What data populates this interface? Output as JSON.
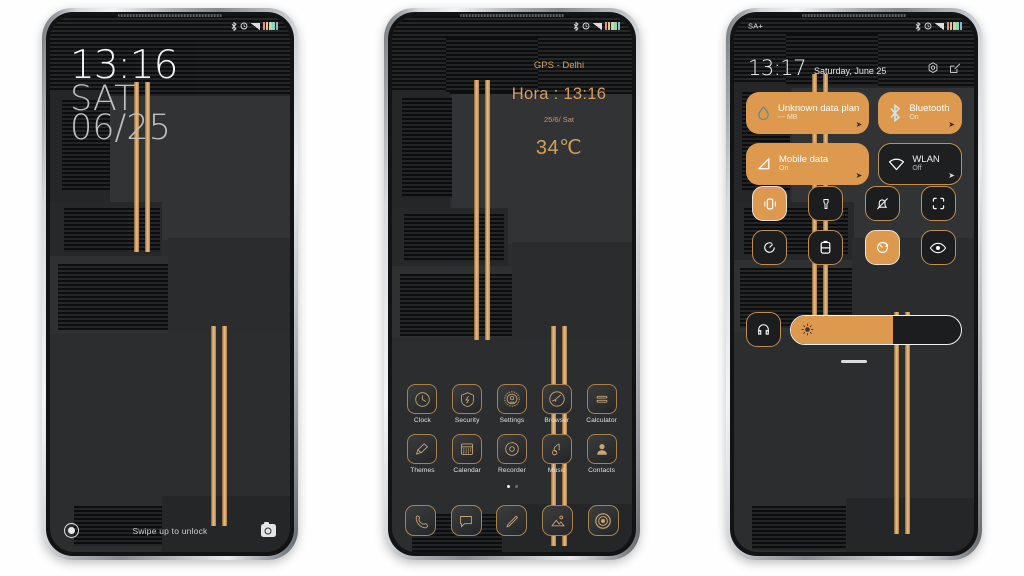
{
  "phone1": {
    "name": "lock-screen",
    "status_bar": {
      "icons": [
        "bluetooth-icon",
        "alarm-icon",
        "signal-icon",
        "battery-icon"
      ],
      "carrier": ""
    },
    "clock": {
      "time": "13:16",
      "day_of_week": "SAT",
      "date": "06/25"
    },
    "bottom": {
      "hint": "Swipe up to unlock",
      "left_icon": "fingerprint-icon",
      "right_icon": "camera-icon"
    }
  },
  "phone2": {
    "name": "home-screen",
    "status_bar": {
      "icons": [
        "bluetooth-icon",
        "alarm-icon",
        "signal-icon",
        "battery-icon"
      ]
    },
    "widget": {
      "location": "GPS - Delhi",
      "time_label": "Hora :  13:16",
      "date": "25/6/ Sat",
      "temperature": "34℃"
    },
    "apps_row1": [
      {
        "label": "Clock",
        "icon": "clock-icon"
      },
      {
        "label": "Security",
        "icon": "shield-icon"
      },
      {
        "label": "Settings",
        "icon": "gear-icon"
      },
      {
        "label": "Browser",
        "icon": "globe-icon"
      },
      {
        "label": "Calculator",
        "icon": "calculator-icon"
      }
    ],
    "apps_row2": [
      {
        "label": "Themes",
        "icon": "brush-icon"
      },
      {
        "label": "Calendar",
        "icon": "calendar-icon"
      },
      {
        "label": "Recorder",
        "icon": "record-icon"
      },
      {
        "label": "Music",
        "icon": "music-note-icon"
      },
      {
        "label": "Contacts",
        "icon": "person-icon"
      }
    ],
    "page_dots": {
      "count": 2,
      "active": 1
    },
    "dock": [
      {
        "icon": "phone-icon"
      },
      {
        "icon": "message-icon"
      },
      {
        "icon": "notes-pencil-icon"
      },
      {
        "icon": "gallery-icon"
      },
      {
        "icon": "camera-icon"
      }
    ]
  },
  "phone3": {
    "name": "notification-panel",
    "status_bar": {
      "carrier": "SA+",
      "icons": [
        "bluetooth-icon",
        "alarm-icon",
        "signal-icon",
        "battery-icon"
      ]
    },
    "header": {
      "time": "13:17",
      "date": "Saturday, June 25",
      "settings_icon": "gear-icon",
      "edit_icon": "edit-icon"
    },
    "tiles_big": [
      {
        "title": "Unknown data plan",
        "subtitle": "--- MB",
        "state": "on",
        "icon": "data-drop-icon"
      },
      {
        "title": "Bluetooth",
        "subtitle": "On",
        "state": "on",
        "icon": "bluetooth-icon"
      },
      {
        "title": "Mobile data",
        "subtitle": "On",
        "state": "on",
        "icon": "mobile-data-icon"
      },
      {
        "title": "WLAN",
        "subtitle": "Off",
        "state": "off",
        "icon": "wifi-icon"
      }
    ],
    "tiles_small": [
      {
        "icon": "vibrate-icon",
        "state": "on"
      },
      {
        "icon": "flashlight-icon",
        "state": "off"
      },
      {
        "icon": "mute-bell-icon",
        "state": "off"
      },
      {
        "icon": "screenshot-icon",
        "state": "off"
      },
      {
        "icon": "auto-rotate-icon",
        "state": "off"
      },
      {
        "icon": "battery-saver-icon",
        "state": "off"
      },
      {
        "icon": "sync-icon",
        "state": "on"
      },
      {
        "icon": "reading-mode-icon",
        "state": "off"
      }
    ],
    "brightness": {
      "icon": "headphone-icon",
      "slider_icon": "sun-icon",
      "value_percent": 60
    },
    "drag_handle": "panel-drag-handle"
  },
  "colors": {
    "gold": "#d6a568",
    "tile_orange": "#dd9a4e",
    "screen_dark": "#2b2d2f",
    "page_background": "#ffffff"
  }
}
